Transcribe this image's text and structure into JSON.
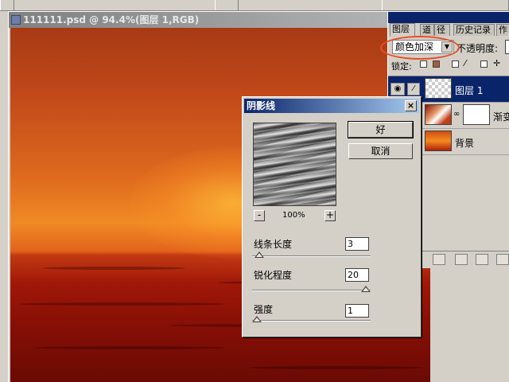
{
  "document": {
    "title": "111111.psd @ 94.4%(图层 1,RGB)"
  },
  "palette": {
    "tabs": [
      "图层",
      "道",
      "径",
      "历史记录",
      "作"
    ],
    "blend_mode": "颜色加深",
    "opacity_label": "不透明度:",
    "lock_label": "锁定:",
    "layers": [
      {
        "name": "图层 1",
        "selected": true
      },
      {
        "name": "渐变",
        "selected": false
      },
      {
        "name": "背景",
        "selected": false
      }
    ]
  },
  "dialog": {
    "title": "阴影线",
    "ok_label": "好",
    "cancel_label": "取消",
    "zoom_minus": "-",
    "zoom_plus": "+",
    "zoom_value": "100%",
    "params": [
      {
        "label": "线条长度",
        "value": "3",
        "slider_fraction": 0.02
      },
      {
        "label": "锐化程度",
        "value": "20",
        "slider_fraction": 1.0
      },
      {
        "label": "强度",
        "value": "1",
        "slider_fraction": 0.0
      }
    ]
  },
  "colors": {
    "title_active": "#0a246a",
    "highlight": "#e8502a",
    "window_face": "#d4d0c8"
  }
}
